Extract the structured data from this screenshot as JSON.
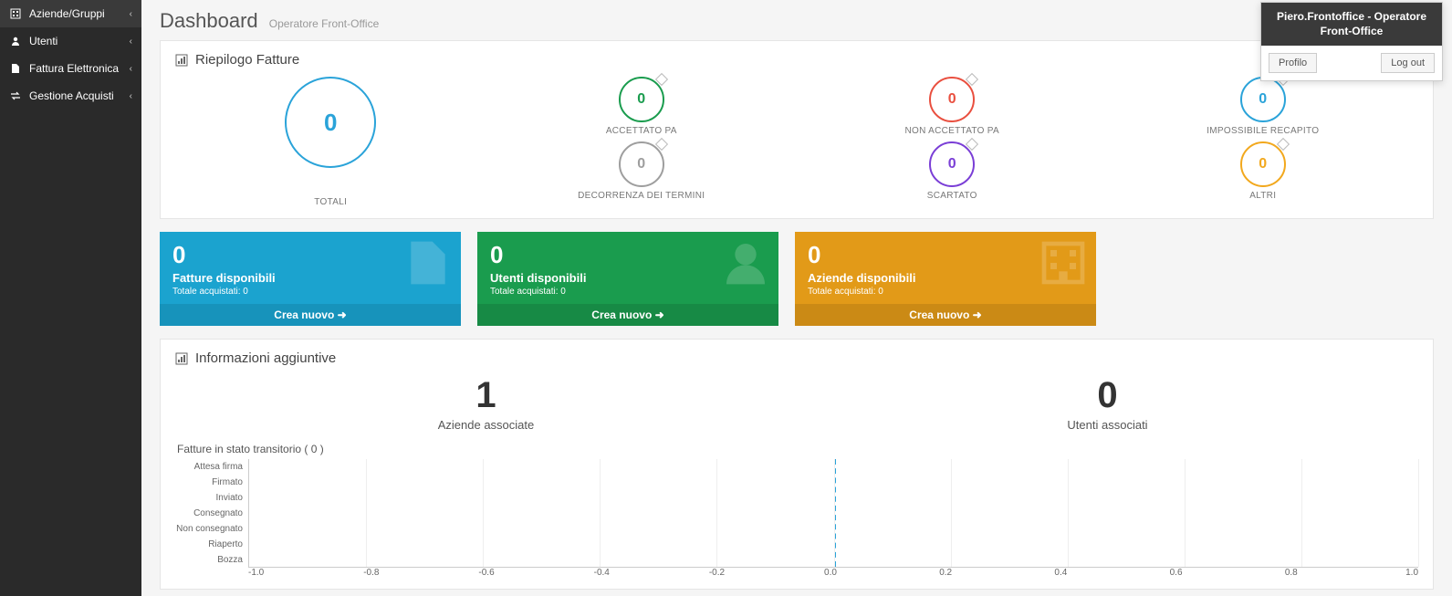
{
  "sidebar": {
    "items": [
      {
        "label": "Aziende/Gruppi",
        "icon": "building"
      },
      {
        "label": "Utenti",
        "icon": "user"
      },
      {
        "label": "Fattura Elettronica",
        "icon": "file"
      },
      {
        "label": "Gestione Acquisti",
        "icon": "transfer"
      }
    ]
  },
  "header": {
    "title": "Dashboard",
    "subtitle": "Operatore Front-Office"
  },
  "user_menu": {
    "name": "Piero.Frontoffice - Operatore Front-Office",
    "profile_label": "Profilo",
    "logout_label": "Log out"
  },
  "summary": {
    "title": "Riepilogo Fatture",
    "total": {
      "value": "0",
      "label": "TOTALI"
    },
    "items": [
      {
        "value": "0",
        "label": "ACCETTATO PA",
        "color": "green"
      },
      {
        "value": "0",
        "label": "NON ACCETTATO PA",
        "color": "red"
      },
      {
        "value": "0",
        "label": "IMPOSSIBILE RECAPITO",
        "color": "blue"
      },
      {
        "value": "0",
        "label": "DECORRENZA DEI TERMINI",
        "color": "gray"
      },
      {
        "value": "0",
        "label": "SCARTATO",
        "color": "purple"
      },
      {
        "value": "0",
        "label": "ALTRI",
        "color": "orange"
      }
    ]
  },
  "cards": [
    {
      "value": "0",
      "title": "Fatture disponibili",
      "sub": "Totale acquistati: 0",
      "action": "Crea nuovo",
      "color": "blue",
      "icon": "file"
    },
    {
      "value": "0",
      "title": "Utenti disponibili",
      "sub": "Totale acquistati: 0",
      "action": "Crea nuovo",
      "color": "green",
      "icon": "user"
    },
    {
      "value": "0",
      "title": "Aziende disponibili",
      "sub": "Totale acquistati: 0",
      "action": "Crea nuovo",
      "color": "orange",
      "icon": "building"
    }
  ],
  "info": {
    "title": "Informazioni aggiuntive",
    "stats": [
      {
        "value": "1",
        "label": "Aziende associate"
      },
      {
        "value": "0",
        "label": "Utenti associati"
      }
    ]
  },
  "chart_data": {
    "type": "bar",
    "title": "Fatture in stato transitorio ( 0 )",
    "categories": [
      "Attesa firma",
      "Firmato",
      "Inviato",
      "Consegnato",
      "Non consegnato",
      "Riaperto",
      "Bozza"
    ],
    "values": [
      0,
      0,
      0,
      0,
      0,
      0,
      0
    ],
    "xlim": [
      -1.0,
      1.0
    ],
    "xticks": [
      "-1.0",
      "-0.8",
      "-0.6",
      "-0.4",
      "-0.2",
      "0.0",
      "0.2",
      "0.4",
      "0.6",
      "0.8",
      "1.0"
    ],
    "orientation": "horizontal"
  }
}
